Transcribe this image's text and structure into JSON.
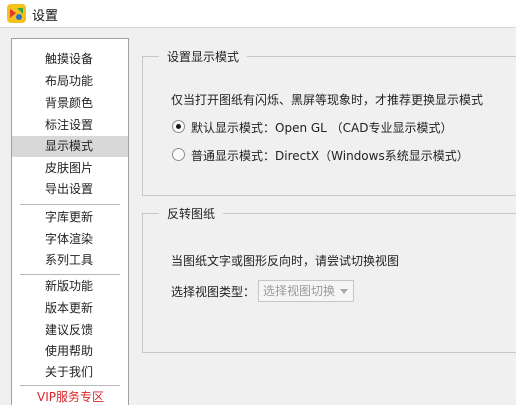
{
  "window": {
    "title": "设置"
  },
  "sidebar": {
    "items": [
      {
        "label": "触摸设备"
      },
      {
        "label": "布局功能"
      },
      {
        "label": "背景颜色"
      },
      {
        "label": "标注设置"
      },
      {
        "label": "显示模式",
        "selected": true
      },
      {
        "label": "皮肤图片"
      },
      {
        "label": "导出设置"
      },
      {
        "label": "字库更新"
      },
      {
        "label": "字体渲染"
      },
      {
        "label": "系列工具"
      },
      {
        "label": "新版功能"
      },
      {
        "label": "版本更新"
      },
      {
        "label": "建议反馈"
      },
      {
        "label": "使用帮助"
      },
      {
        "label": "关于我们"
      },
      {
        "label": "VIP服务专区"
      }
    ],
    "vip_color": "#d8262c"
  },
  "display_mode": {
    "group_title": "设置显示模式",
    "hint": "仅当打开图纸有闪烁、黑屏等现象时，才推荐更换显示模式",
    "options": [
      {
        "label": "默认显示模式：Open GL （CAD专业显示模式）",
        "checked": true
      },
      {
        "label": "普通显示模式：DirectX（Windows系统显示模式）",
        "checked": false
      }
    ]
  },
  "reverse": {
    "group_title": "反转图纸",
    "hint": "当图纸文字或图形反向时，请尝试切换视图",
    "view_type_label": "选择视图类型：",
    "view_type_value": "选择视图切换"
  }
}
